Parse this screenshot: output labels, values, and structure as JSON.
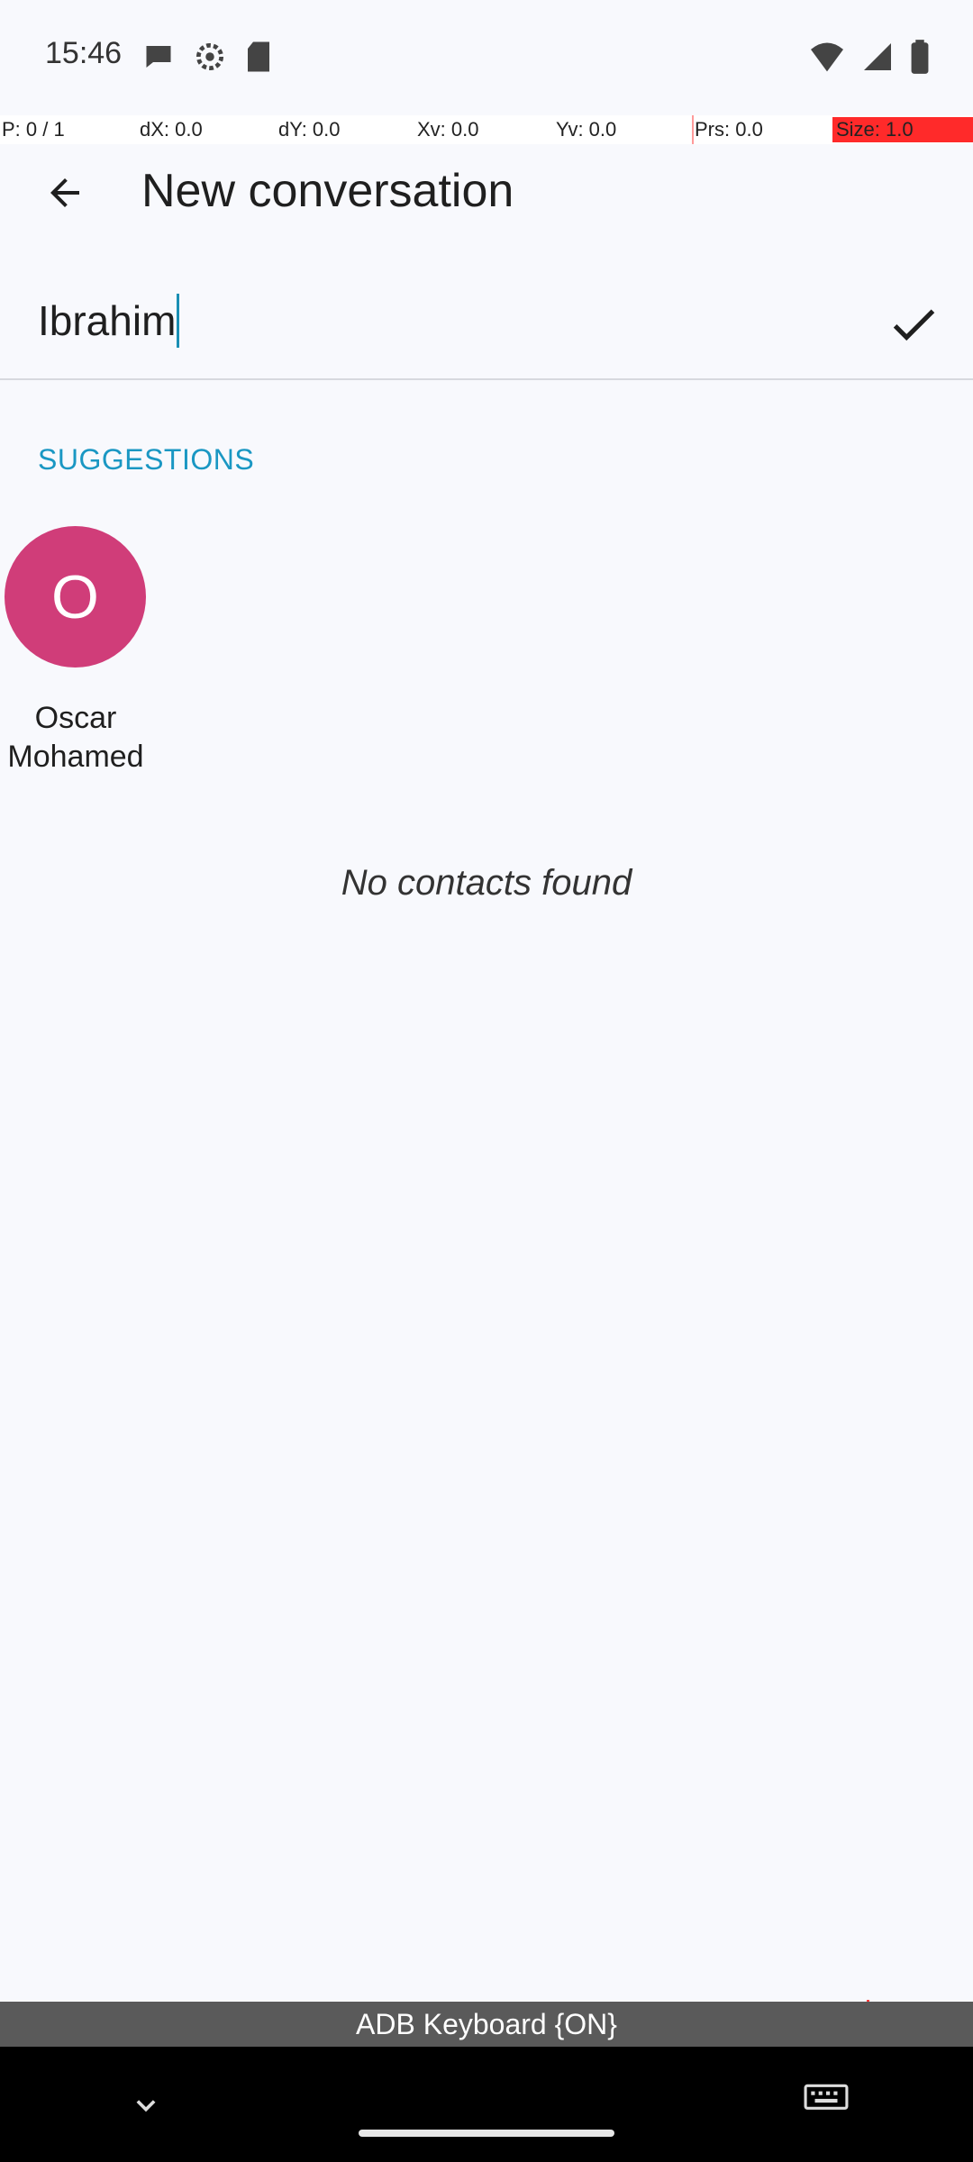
{
  "status_bar": {
    "time": "15:46",
    "left_icons": [
      "chat-notification-icon",
      "settings-icon",
      "sd-card-icon"
    ],
    "right_icons": [
      "wifi-alert-icon",
      "signal-icon",
      "battery-icon"
    ]
  },
  "pointer_bar": {
    "p": "P: 0 / 1",
    "dx": "dX: 0.0",
    "dy": "dY: 0.0",
    "xv": "Xv: 0.0",
    "yv": "Yv: 0.0",
    "prs": "Prs: 0.0",
    "size": "Size: 1.0",
    "size_color": "#ff2a2a"
  },
  "app_bar": {
    "title": "New conversation",
    "back_icon": "arrow-back-icon"
  },
  "recipient": {
    "value": "Ibrahim",
    "confirm_icon": "check-icon"
  },
  "suggestions": {
    "header": "SUGGESTIONS",
    "header_color": "#1a97c3",
    "items": [
      {
        "initial": "O",
        "name": "Oscar Mohamed",
        "avatar_color": "#d03d79"
      }
    ]
  },
  "empty_state": "No contacts found",
  "ime": {
    "label": "ADB Keyboard {ON}"
  },
  "nav_bar": {
    "icons": [
      "chevron-down-icon",
      "home-handle",
      "keyboard-icon"
    ]
  }
}
